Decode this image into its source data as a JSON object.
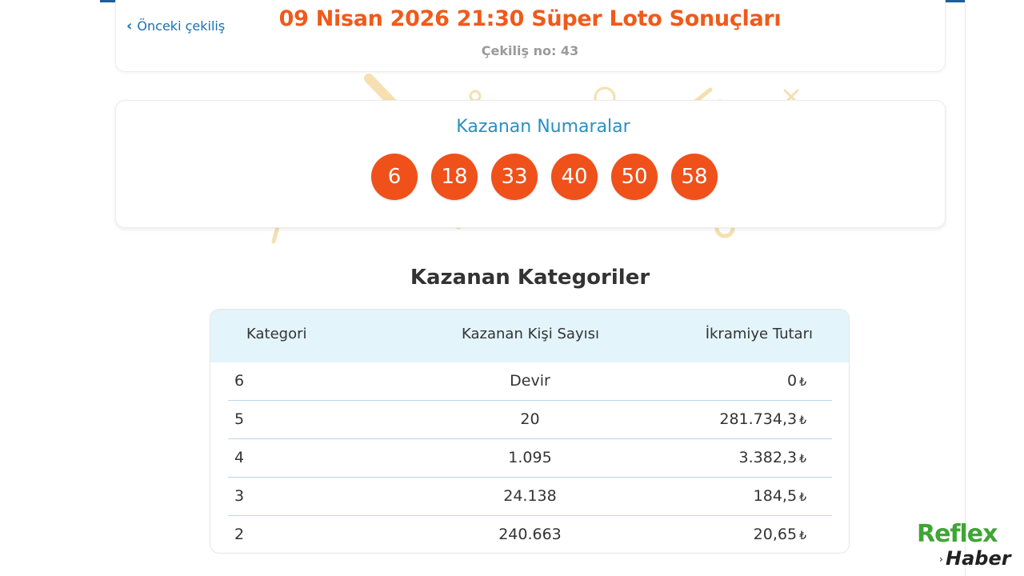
{
  "header": {
    "back_label": "Önceki çekiliş",
    "title": "09 Nisan 2026 21:30 Süper Loto Sonuçları",
    "draw_number": "Çekiliş no: 43"
  },
  "winning_numbers": {
    "title": "Kazanan Numaralar",
    "balls": [
      "6",
      "18",
      "33",
      "40",
      "50",
      "58"
    ]
  },
  "categories": {
    "title": "Kazanan Kategoriler",
    "columns": [
      "Kategori",
      "Kazanan Kişi Sayısı",
      "İkramiye Tutarı"
    ],
    "currency_symbol": "₺",
    "rows": [
      {
        "category": "6",
        "winners": "Devir",
        "prize": "0"
      },
      {
        "category": "5",
        "winners": "20",
        "prize": "281.734,3"
      },
      {
        "category": "4",
        "winners": "1.095",
        "prize": "3.382,3"
      },
      {
        "category": "3",
        "winners": "24.138",
        "prize": "184,5"
      },
      {
        "category": "2",
        "winners": "240.663",
        "prize": "20,65"
      }
    ]
  },
  "logo": {
    "top": "Reflex",
    "bottom": "Haber"
  },
  "colors": {
    "accent_orange": "#f05a1a",
    "ball_orange": "#f0501a",
    "title_blue": "#2a8fbf",
    "link_blue": "#1a6fb3",
    "table_header_bg": "#e3f4fb",
    "confetti": "#f6dfb0",
    "logo_green": "#3fa535"
  }
}
